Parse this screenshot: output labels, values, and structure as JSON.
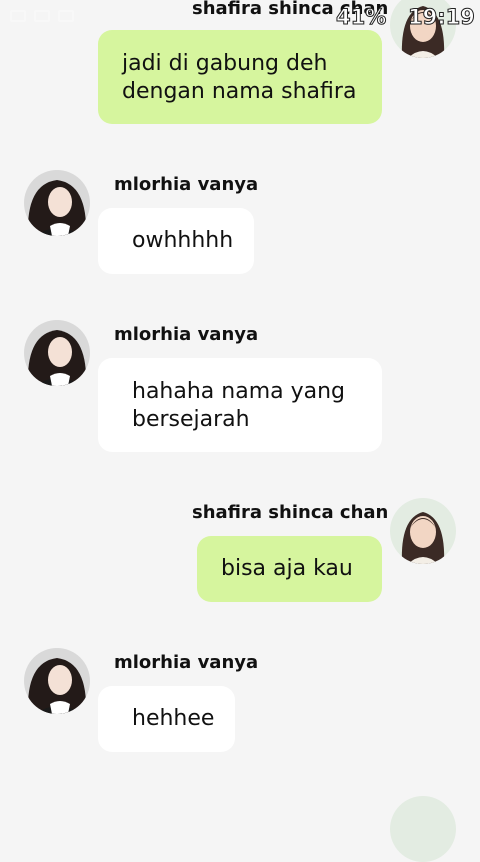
{
  "status_bar": {
    "battery": "41%",
    "time": "19:19"
  },
  "messages": [
    {
      "sender": "shafira shinca chan",
      "text": "jadi di gabung deh dengan nama shafira",
      "side": "right"
    },
    {
      "sender": "mlorhia  vanya",
      "text": "owhhhhh",
      "side": "left"
    },
    {
      "sender": "mlorhia  vanya",
      "text": "hahaha nama yang bersejarah",
      "side": "left"
    },
    {
      "sender": "shafira shinca chan",
      "text": "bisa aja kau",
      "side": "right"
    },
    {
      "sender": "mlorhia  vanya",
      "text": "hehhee",
      "side": "left"
    }
  ],
  "colors": {
    "background": "#f5f5f5",
    "mine_bubble": "#d6f59e",
    "theirs_bubble": "#ffffff"
  }
}
